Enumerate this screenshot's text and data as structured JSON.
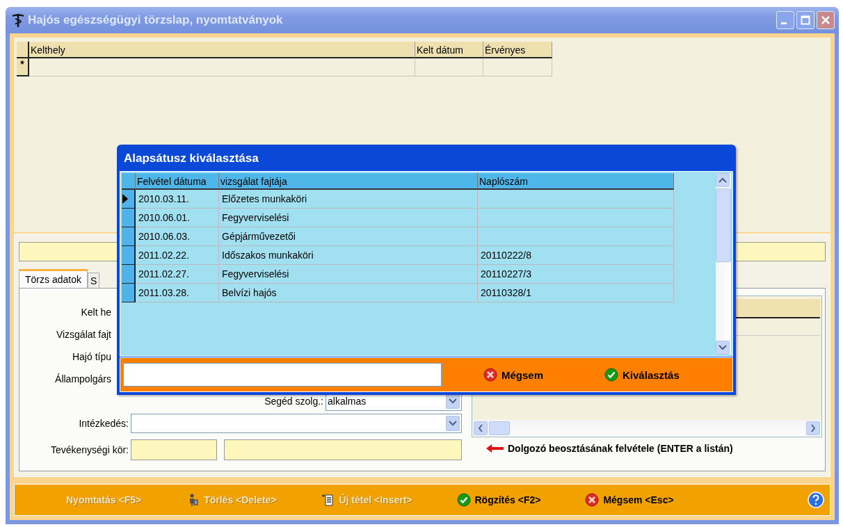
{
  "window": {
    "title": "Hajós egészségügyi törzslap, nyomtatványok"
  },
  "top_grid": {
    "columns": [
      "Kelthely",
      "Kelt dátum",
      "Érvényes"
    ],
    "new_row_marker": "*"
  },
  "tabs": [
    {
      "label": "Törzs adatok",
      "selected": true
    },
    {
      "label": "S",
      "selected": false
    }
  ],
  "form": {
    "hidden_labels": [
      "Kelt he",
      "Vizsgálat fajt",
      "Hajó típu",
      "Állampolgárs"
    ],
    "seged_szolg": {
      "label": "Segéd szolg.:",
      "value": "alkalmas"
    },
    "intezkedes": {
      "label": "Intézkedés:"
    },
    "tevekenysegi_kor": {
      "label": "Tevékenységi kör:"
    }
  },
  "hint": "Dolgozó beosztásának felvétele (ENTER a listán)",
  "toolbar": [
    {
      "label": "Nyomtatás <F5>",
      "kind": "none",
      "disabled": true
    },
    {
      "label": "Törlés <Delete>",
      "kind": "figure",
      "disabled": true
    },
    {
      "label": "Új tétel <Insert>",
      "kind": "list",
      "disabled": true
    },
    {
      "label": "Rögzítés <F2>",
      "kind": "check",
      "disabled": false
    },
    {
      "label": "Mégsem <Esc>",
      "kind": "cancel",
      "disabled": false
    }
  ],
  "dialog": {
    "title": "Alapsátusz kiválasztása",
    "columns": [
      "Felvétel dátuma",
      "vizsgálat fajtája",
      "Naplószám"
    ],
    "rows": [
      {
        "date": "2010.03.11.",
        "type": "Előzetes munkaköri",
        "log": "",
        "selected": true
      },
      {
        "date": "2010.06.01.",
        "type": "Fegyverviselési",
        "log": "",
        "selected": false
      },
      {
        "date": "2010.06.03.",
        "type": "Gépjárművezetői",
        "log": "",
        "selected": false
      },
      {
        "date": "2011.02.22.",
        "type": "Időszakos munkaköri",
        "log": "20110222/8",
        "selected": false
      },
      {
        "date": "2011.02.27.",
        "type": "Fegyverviselési",
        "log": "20110227/3",
        "selected": false
      },
      {
        "date": "2011.03.28.",
        "type": "Belvízi hajós",
        "log": "20110328/1",
        "selected": false
      }
    ],
    "buttons": [
      {
        "label": "Mégsem",
        "kind": "cancel"
      },
      {
        "label": "Kiválasztás",
        "kind": "check"
      }
    ]
  }
}
